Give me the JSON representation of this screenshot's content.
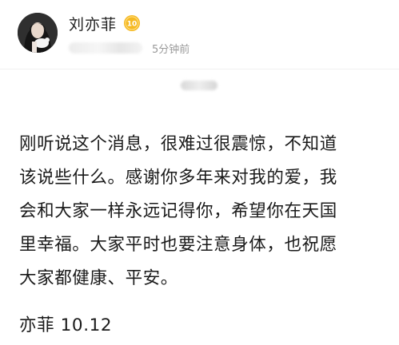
{
  "user": {
    "name": "刘亦菲",
    "badge_level": "10",
    "badge_color": "#f5b923",
    "post_time": "5分钟前"
  },
  "post": {
    "lines": [
      "刚听说这个消息，很难过很震惊，不知道",
      "该说些什么。感谢你多年来对我的爱，我",
      "会和大家一样永远记得你，希望你在天国",
      "里幸福。大家平时也要注意身体，也祝愿",
      "大家都健康、平安。"
    ],
    "signature": "亦菲 10.12"
  },
  "icons": {
    "avatar": "avatar-photo",
    "badge": "vip-level-badge"
  }
}
